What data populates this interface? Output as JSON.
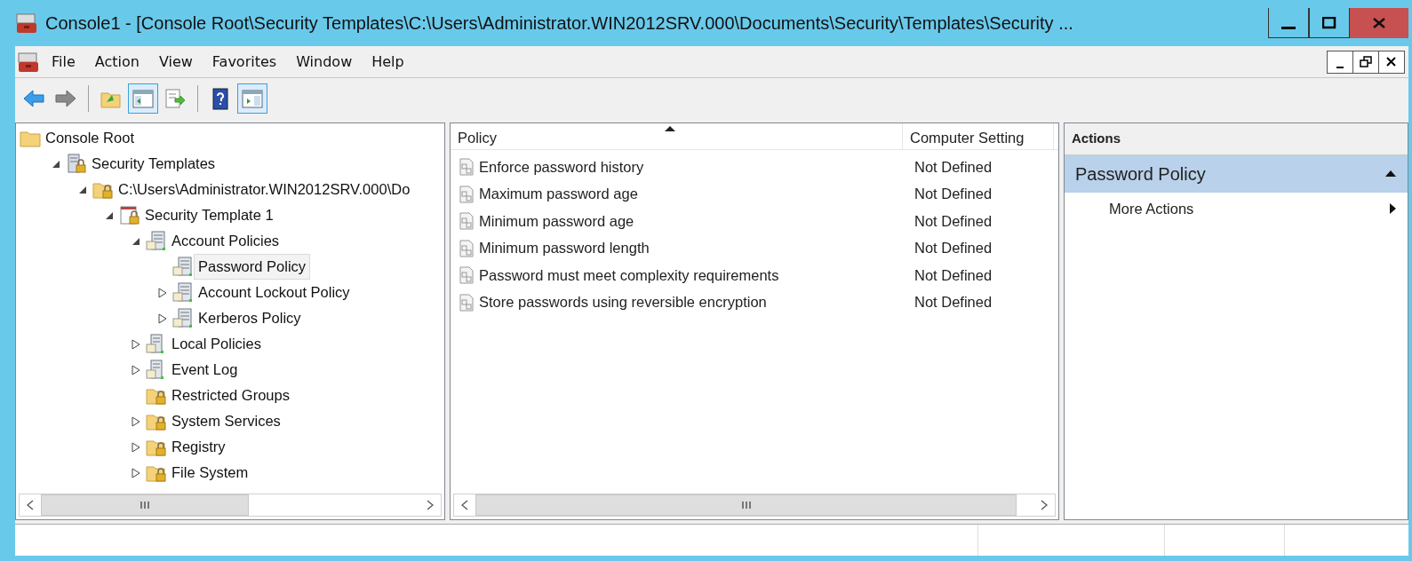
{
  "window": {
    "title": "Console1 - [Console Root\\Security Templates\\C:\\Users\\Administrator.WIN2012SRV.000\\Documents\\Security\\Templates\\Security ..."
  },
  "menu": [
    "File",
    "Action",
    "View",
    "Favorites",
    "Window",
    "Help"
  ],
  "toolbar": [
    [
      {
        "pressed": false
      },
      {
        "pressed": false
      }
    ],
    [
      {
        "pressed": false
      },
      {
        "pressed": true
      },
      {
        "pressed": false
      }
    ],
    [
      {
        "pressed": false
      },
      {
        "pressed": true
      }
    ]
  ],
  "tree": [
    {
      "label": "Console Root",
      "kind": "folder",
      "selected": false,
      "children": [
        {
          "label": "Security Templates",
          "kind": "store",
          "expanded": true,
          "selected": false,
          "children": [
            {
              "label": "C:\\Users\\Administrator.WIN2012SRV.000\\Do",
              "kind": "lockfolder",
              "expanded": true,
              "selected": false,
              "children": [
                {
                  "label": "Security Template 1",
                  "kind": "template",
                  "expanded": true,
                  "selected": false,
                  "children": [
                    {
                      "label": "Account Policies",
                      "kind": "policy",
                      "expanded": true,
                      "selected": false,
                      "children": [
                        {
                          "label": "Password Policy",
                          "kind": "policy",
                          "selected": true
                        },
                        {
                          "label": "Account Lockout Policy",
                          "kind": "policy",
                          "expanded": false,
                          "selected": false
                        },
                        {
                          "label": "Kerberos Policy",
                          "kind": "policy",
                          "expanded": false,
                          "selected": false
                        }
                      ]
                    },
                    {
                      "label": "Local Policies",
                      "kind": "server",
                      "expanded": false,
                      "selected": false
                    },
                    {
                      "label": "Event Log",
                      "kind": "server",
                      "expanded": false,
                      "selected": false
                    },
                    {
                      "label": "Restricted Groups",
                      "kind": "lockfolder",
                      "selected": false
                    },
                    {
                      "label": "System Services",
                      "kind": "lockfolder",
                      "expanded": false,
                      "selected": false
                    },
                    {
                      "label": "Registry",
                      "kind": "lockfolder",
                      "expanded": false,
                      "selected": false
                    },
                    {
                      "label": "File System",
                      "kind": "lockfolder",
                      "expanded": false,
                      "selected": false
                    }
                  ]
                }
              ]
            }
          ]
        }
      ]
    }
  ],
  "table": {
    "columns": [
      {
        "label": "Policy",
        "sorted": true
      },
      {
        "label": "Computer Setting",
        "sorted": false
      }
    ],
    "rows": [
      [
        "Enforce password history",
        "Not Defined"
      ],
      [
        "Maximum password age",
        "Not Defined"
      ],
      [
        "Minimum password age",
        "Not Defined"
      ],
      [
        "Minimum password length",
        "Not Defined"
      ],
      [
        "Password must meet complexity requirements",
        "Not Defined"
      ],
      [
        "Store passwords using reversible encryption",
        "Not Defined"
      ]
    ]
  },
  "actions": {
    "title": "Actions",
    "section": {
      "label": "Password Policy",
      "expanded": true
    },
    "items": [
      {
        "label": "More Actions",
        "submenu": true
      }
    ]
  }
}
